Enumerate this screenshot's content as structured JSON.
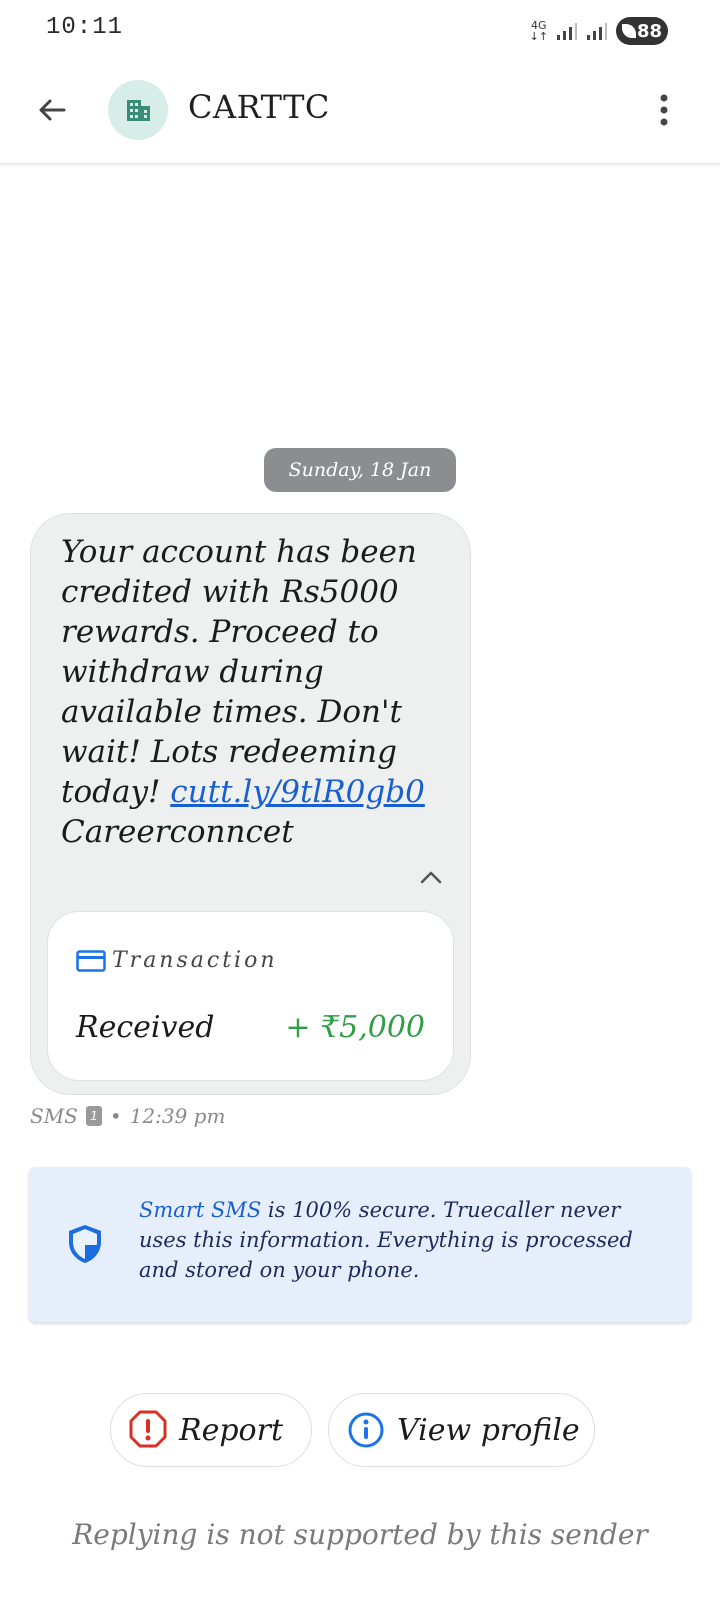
{
  "status_bar": {
    "time": "10:11",
    "network": "4G",
    "battery": "88"
  },
  "header": {
    "sender_name": "CARTTC",
    "avatar_icon": "building-icon",
    "back_icon": "back-arrow-icon",
    "menu_icon": "more-vert-icon"
  },
  "thread": {
    "date_chip": "Sunday, 18 Jan",
    "message": {
      "text_before_link": "Your account has been credited with Rs5000 rewards. Proceed to withdraw during available times. Don't wait! Lots redeeming today! ",
      "link": "cutt.ly/9tlR0gb0",
      "text_after_link": "Careerconncet",
      "collapse_icon": "chevron-up-icon"
    },
    "transaction_card": {
      "title": "Transaction",
      "icon": "card-icon",
      "label": "Received",
      "amount": "+ ₹5,000"
    },
    "meta": {
      "channel": "SMS",
      "sim": "1",
      "separator": "•",
      "time": "12:39 pm"
    }
  },
  "info_box": {
    "accent": "Smart SMS",
    "text": " is 100% secure. Truecaller never uses this information. Everything is processed and stored on your phone.",
    "icon": "shield-icon"
  },
  "actions": {
    "report_label": "Report",
    "report_icon": "report-icon",
    "view_profile_label": "View profile",
    "view_profile_icon": "info-icon"
  },
  "footer": {
    "reply_note": "Replying is not supported by this sender"
  },
  "colors": {
    "link": "#1a5fd0",
    "amount_green": "#2f9e44",
    "report_red": "#d93025",
    "info_blue": "#1a5fd0",
    "avatar_bg": "#d7ede8"
  }
}
